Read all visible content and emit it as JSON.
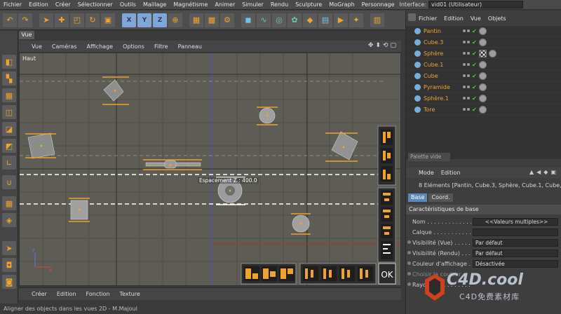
{
  "menubar": {
    "items": [
      "Fichier",
      "Edition",
      "Créer",
      "Sélectionner",
      "Outils",
      "Maillage",
      "Magnétisme",
      "Animer",
      "Simuler",
      "Rendu",
      "Sculpture",
      "MoGraph",
      "Personnage"
    ],
    "interface_label": "Interface:",
    "interface_value": "vid01 (Utilisateur)"
  },
  "toolbar": {
    "axis_x": "X",
    "axis_y": "Y",
    "axis_z": "Z"
  },
  "view": {
    "tab": "Vue",
    "menu": [
      "Vue",
      "Caméras",
      "Affichage",
      "Options",
      "Filtre",
      "Panneau"
    ],
    "label": "Haut",
    "spacing_label": "Espacement Z : 400.0",
    "ok_label": "OK"
  },
  "bottom_menu": [
    "Créer",
    "Edition",
    "Fonction",
    "Texture"
  ],
  "status": "Aligner des objects dans les vues 2D - M.Majoul",
  "object_manager": {
    "menu": [
      "Fichier",
      "Edition",
      "Vue",
      "Objets"
    ],
    "objects": [
      {
        "name": "Pantin",
        "color": "#6fb0e0",
        "tags": 1
      },
      {
        "name": "Cube.3",
        "color": "#6fb0e0",
        "tags": 1
      },
      {
        "name": "Sphère",
        "color": "#6fb0e0",
        "tags": 2
      },
      {
        "name": "Cube.1",
        "color": "#6fb0e0",
        "tags": 1
      },
      {
        "name": "Cube",
        "color": "#6fb0e0",
        "tags": 1
      },
      {
        "name": "Pyramide",
        "color": "#6fb0e0",
        "tags": 1
      },
      {
        "name": "Sphère.1",
        "color": "#6fb0e0",
        "tags": 1
      },
      {
        "name": "Tore",
        "color": "#6fb0e0",
        "tags": 1
      }
    ],
    "palette": "Palette vide"
  },
  "attributes": {
    "menu": [
      "Mode",
      "Edition"
    ],
    "info": "8 Eléments [Pantin, Cube.3, Sphère, Cube.1, Cube,",
    "tabs": [
      "Base",
      "Coord."
    ],
    "section": "Caractéristiques de base",
    "rows": [
      {
        "label": "Nom . . . . . . . . . . . . .",
        "value": "<<Valeurs multiples>>"
      },
      {
        "label": "Calque . . . . . . . . . . .",
        "value": ""
      },
      {
        "label": "Visibilité (Vue) . . . . .",
        "value": "Par défaut"
      },
      {
        "label": "Visibilité (Rendu) . . .",
        "value": "Par défaut"
      },
      {
        "label": "Couleur d'affichage .",
        "value": "Désactivée"
      },
      {
        "label": "Choisir la couleur",
        "value": ""
      },
      {
        "label": "Rayons-X . . . . . . . . .",
        "value": ""
      }
    ]
  },
  "watermark": {
    "title": "C4D.cool",
    "subtitle": "C4D免费素材库"
  },
  "colors": {
    "accent": "#f1a22a",
    "object_text": "#f3a02c",
    "axis_blue": "#4a4ad0"
  }
}
